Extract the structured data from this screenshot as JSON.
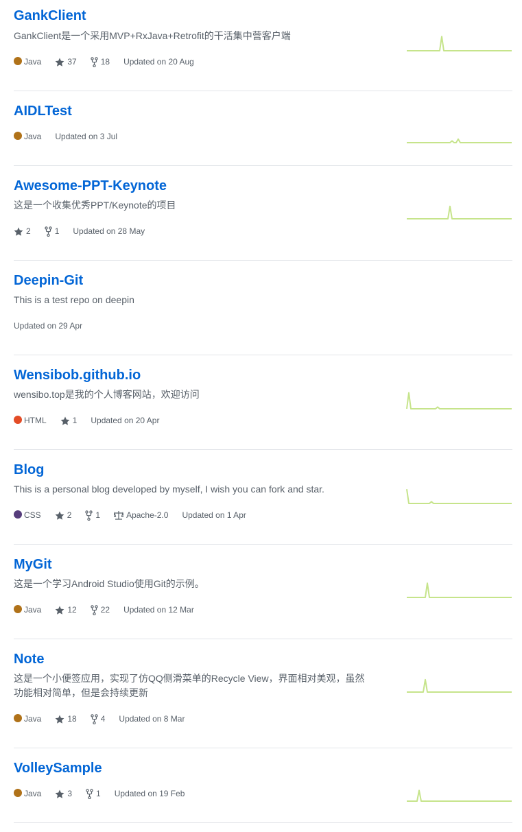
{
  "repositories": [
    {
      "name": "GankClient",
      "description": "GankClient是一个采用MVP+RxJava+Retrofit的干活集中营客户端",
      "language": "Java",
      "language_color": "#b07219",
      "stars": "37",
      "forks": "18",
      "license": null,
      "updated": "Updated on 20 Aug",
      "activity": [
        0,
        0,
        0,
        0,
        0,
        0,
        0,
        0,
        0,
        0,
        0,
        0,
        0,
        0,
        0,
        0,
        0,
        8,
        0,
        0,
        0,
        0,
        0,
        0,
        0,
        0,
        0,
        0,
        0,
        0,
        0,
        0,
        0,
        0,
        0,
        0,
        0,
        0,
        0,
        0,
        0,
        0,
        0,
        0,
        0,
        0,
        0,
        0,
        0,
        0,
        0,
        0
      ]
    },
    {
      "name": "AIDLTest",
      "description": null,
      "language": "Java",
      "language_color": "#b07219",
      "stars": null,
      "forks": null,
      "license": null,
      "updated": "Updated on 3 Jul",
      "activity": [
        0,
        0,
        0,
        0,
        0,
        0,
        0,
        0,
        0,
        0,
        0,
        0,
        0,
        0,
        0,
        0,
        0,
        0,
        0,
        0,
        0,
        0,
        1,
        0,
        0,
        2,
        0,
        0,
        0,
        0,
        0,
        0,
        0,
        0,
        0,
        0,
        0,
        0,
        0,
        0,
        0,
        0,
        0,
        0,
        0,
        0,
        0,
        0,
        0,
        0,
        0,
        0
      ]
    },
    {
      "name": "Awesome-PPT-Keynote",
      "description": "这是一个收集优秀PPT/Keynote的项目",
      "language": null,
      "language_color": null,
      "stars": "2",
      "forks": "1",
      "license": null,
      "updated": "Updated on 28 May",
      "activity": [
        0,
        0,
        0,
        0,
        0,
        0,
        0,
        0,
        0,
        0,
        0,
        0,
        0,
        0,
        0,
        0,
        0,
        0,
        0,
        0,
        0,
        7,
        0,
        0,
        0,
        0,
        0,
        0,
        0,
        0,
        0,
        0,
        0,
        0,
        0,
        0,
        0,
        0,
        0,
        0,
        0,
        0,
        0,
        0,
        0,
        0,
        0,
        0,
        0,
        0,
        0,
        0
      ]
    },
    {
      "name": "Deepin-Git",
      "description": "This is a test repo on deepin",
      "language": null,
      "language_color": null,
      "stars": null,
      "forks": null,
      "license": null,
      "updated": "Updated on 29 Apr",
      "activity": null
    },
    {
      "name": "Wensibob.github.io",
      "description": "wensibo.top是我的个人博客网站，欢迎访问",
      "language": "HTML",
      "language_color": "#e34c26",
      "stars": "1",
      "forks": null,
      "license": null,
      "updated": "Updated on 20 Apr",
      "activity": [
        0,
        9,
        0,
        0,
        0,
        0,
        0,
        0,
        0,
        0,
        0,
        0,
        0,
        0,
        0,
        1,
        0,
        0,
        0,
        0,
        0,
        0,
        0,
        0,
        0,
        0,
        0,
        0,
        0,
        0,
        0,
        0,
        0,
        0,
        0,
        0,
        0,
        0,
        0,
        0,
        0,
        0,
        0,
        0,
        0,
        0,
        0,
        0,
        0,
        0,
        0,
        0
      ]
    },
    {
      "name": "Blog",
      "description": "This is a personal blog developed by myself, I wish you can fork and star.",
      "language": "CSS",
      "language_color": "#563d7c",
      "stars": "2",
      "forks": "1",
      "license": "Apache-2.0",
      "updated": "Updated on 1 Apr",
      "activity": [
        8,
        0,
        0,
        0,
        0,
        0,
        0,
        0,
        0,
        0,
        0,
        0,
        1,
        0,
        0,
        0,
        0,
        0,
        0,
        0,
        0,
        0,
        0,
        0,
        0,
        0,
        0,
        0,
        0,
        0,
        0,
        0,
        0,
        0,
        0,
        0,
        0,
        0,
        0,
        0,
        0,
        0,
        0,
        0,
        0,
        0,
        0,
        0,
        0,
        0,
        0,
        0
      ]
    },
    {
      "name": "MyGit",
      "description": "这是一个学习Android Studio使用Git的示例。",
      "language": "Java",
      "language_color": "#b07219",
      "stars": "12",
      "forks": "22",
      "license": null,
      "updated": "Updated on 12 Mar",
      "activity": [
        0,
        0,
        0,
        0,
        0,
        0,
        0,
        0,
        0,
        0,
        8,
        0,
        0,
        0,
        0,
        0,
        0,
        0,
        0,
        0,
        0,
        0,
        0,
        0,
        0,
        0,
        0,
        0,
        0,
        0,
        0,
        0,
        0,
        0,
        0,
        0,
        0,
        0,
        0,
        0,
        0,
        0,
        0,
        0,
        0,
        0,
        0,
        0,
        0,
        0,
        0,
        0
      ]
    },
    {
      "name": "Note",
      "description": "这是一个小便签应用，实现了仿QQ侧滑菜单的Recycle View，界面相对美观，虽然功能相对简单，但是会持续更新",
      "language": "Java",
      "language_color": "#b07219",
      "stars": "18",
      "forks": "4",
      "license": null,
      "updated": "Updated on 8 Mar",
      "activity": [
        0,
        0,
        0,
        0,
        0,
        0,
        0,
        0,
        0,
        7,
        0,
        0,
        0,
        0,
        0,
        0,
        0,
        0,
        0,
        0,
        0,
        0,
        0,
        0,
        0,
        0,
        0,
        0,
        0,
        0,
        0,
        0,
        0,
        0,
        0,
        0,
        0,
        0,
        0,
        0,
        0,
        0,
        0,
        0,
        0,
        0,
        0,
        0,
        0,
        0,
        0,
        0
      ]
    },
    {
      "name": "VolleySample",
      "description": null,
      "language": "Java",
      "language_color": "#b07219",
      "stars": "3",
      "forks": "1",
      "license": null,
      "updated": "Updated on 19 Feb",
      "activity": [
        0,
        0,
        0,
        0,
        0,
        0,
        6,
        0,
        0,
        0,
        0,
        0,
        0,
        0,
        0,
        0,
        0,
        0,
        0,
        0,
        0,
        0,
        0,
        0,
        0,
        0,
        0,
        0,
        0,
        0,
        0,
        0,
        0,
        0,
        0,
        0,
        0,
        0,
        0,
        0,
        0,
        0,
        0,
        0,
        0,
        0,
        0,
        0,
        0,
        0,
        0,
        0
      ]
    }
  ]
}
